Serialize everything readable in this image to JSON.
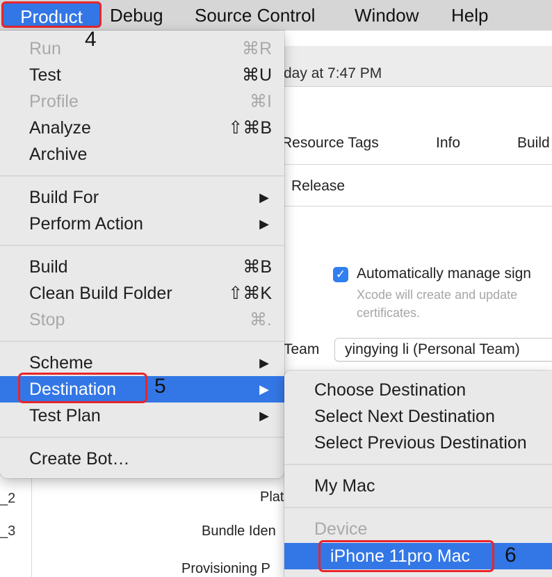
{
  "menubar": {
    "items": [
      "Product",
      "Debug",
      "Source Control",
      "Window",
      "Help"
    ]
  },
  "product_menu": {
    "groups": [
      [
        {
          "label": "Run",
          "shortcut": "⌘R",
          "enabled": false
        },
        {
          "label": "Test",
          "shortcut": "⌘U",
          "enabled": true
        },
        {
          "label": "Profile",
          "shortcut": "⌘I",
          "enabled": false
        },
        {
          "label": "Analyze",
          "shortcut": "⇧⌘B",
          "enabled": true
        },
        {
          "label": "Archive",
          "shortcut": "",
          "enabled": true
        }
      ],
      [
        {
          "label": "Build For",
          "submenu": true
        },
        {
          "label": "Perform Action",
          "submenu": true
        }
      ],
      [
        {
          "label": "Build",
          "shortcut": "⌘B",
          "enabled": true
        },
        {
          "label": "Clean Build Folder",
          "shortcut": "⇧⌘K",
          "enabled": true
        },
        {
          "label": "Stop",
          "shortcut": "⌘.",
          "enabled": false
        }
      ],
      [
        {
          "label": "Scheme",
          "submenu": true
        },
        {
          "label": "Destination",
          "submenu": true,
          "highlighted": true
        },
        {
          "label": "Test Plan",
          "submenu": true
        }
      ],
      [
        {
          "label": "Create Bot…"
        }
      ]
    ],
    "submenu_arrow": "▶"
  },
  "destination_menu": {
    "items": [
      "Choose Destination",
      "Select Next Destination",
      "Select Previous Destination"
    ],
    "my_mac": "My Mac",
    "device_header": "Device",
    "selected_device": "iPhone 11pro Mac"
  },
  "background": {
    "modified": "day at 7:47 PM",
    "tabs": [
      "Resource Tags",
      "Info",
      "Build"
    ],
    "config": "Release",
    "auto_signing": "Automatically manage sign",
    "auto_signing_help_1": "Xcode will create and update",
    "auto_signing_help_2": "certificates.",
    "team_label": "Team",
    "team_value": "yingying li (Personal Team)",
    "sidebar_items": [
      "_2",
      "_3"
    ],
    "fields": [
      "Plat",
      "Bundle Iden",
      "Provisioning P"
    ]
  },
  "annotations": {
    "step_product": "4",
    "step_destination": "5",
    "step_device": "6"
  },
  "colors": {
    "highlight": "#3377e6",
    "annotation_border": "#e8252b",
    "checkbox": "#2f7ff0"
  }
}
